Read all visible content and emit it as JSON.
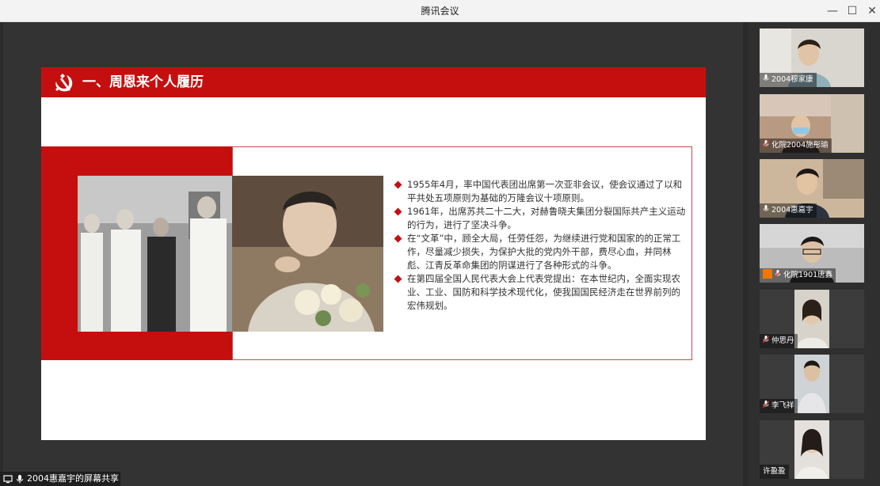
{
  "window": {
    "title": "腾讯会议",
    "controls": {
      "minimize": "—",
      "maximize": "☐",
      "close": "✕"
    }
  },
  "slide": {
    "title": "一、周恩来个人履历",
    "bullets": [
      "1955年4月，率中国代表团出席第一次亚非会议，使会议通过了以和平共处五项原则为基础的万隆会议十项原则。",
      "1961年，出席苏共二十二大，对赫鲁晓夫集团分裂国际共产主义运动的行为，进行了坚决斗争。",
      "在“文革”中，顾全大局，任劳任怨，为继续进行党和国家的的正常工作，尽量减少损失，为保护大批的党内外干部，费尽心血，并同林彪、江青反革命集团的阴谋进行了各种形式的斗争。",
      "在第四届全国人民代表大会上代表党提出：在本世纪内，全面实现农业、工业、国防和科学技术现代化，使我国国民经济走在世界前列的宏伟规划。"
    ],
    "colors": {
      "accent": "#c50f0f",
      "frame": "#c94a4a"
    }
  },
  "share_bar": {
    "label": "2004惠嘉宇的屏幕共享"
  },
  "participants": [
    {
      "name": "2004穆家康",
      "icon": "mic-icon",
      "host": false
    },
    {
      "name": "化院2004施彤瑜",
      "icon": "mic-muted-icon",
      "host": false
    },
    {
      "name": "2004惠嘉宇",
      "icon": "mic-icon",
      "host": false
    },
    {
      "name": "化院1901唐鑫",
      "icon": "mic-muted-icon",
      "host": true
    },
    {
      "name": "仲思丹",
      "icon": "mic-muted-icon",
      "host": false
    },
    {
      "name": "李飞祥",
      "icon": "mic-muted-icon",
      "host": false
    },
    {
      "name": "许盈盈",
      "icon": "",
      "host": false
    }
  ]
}
